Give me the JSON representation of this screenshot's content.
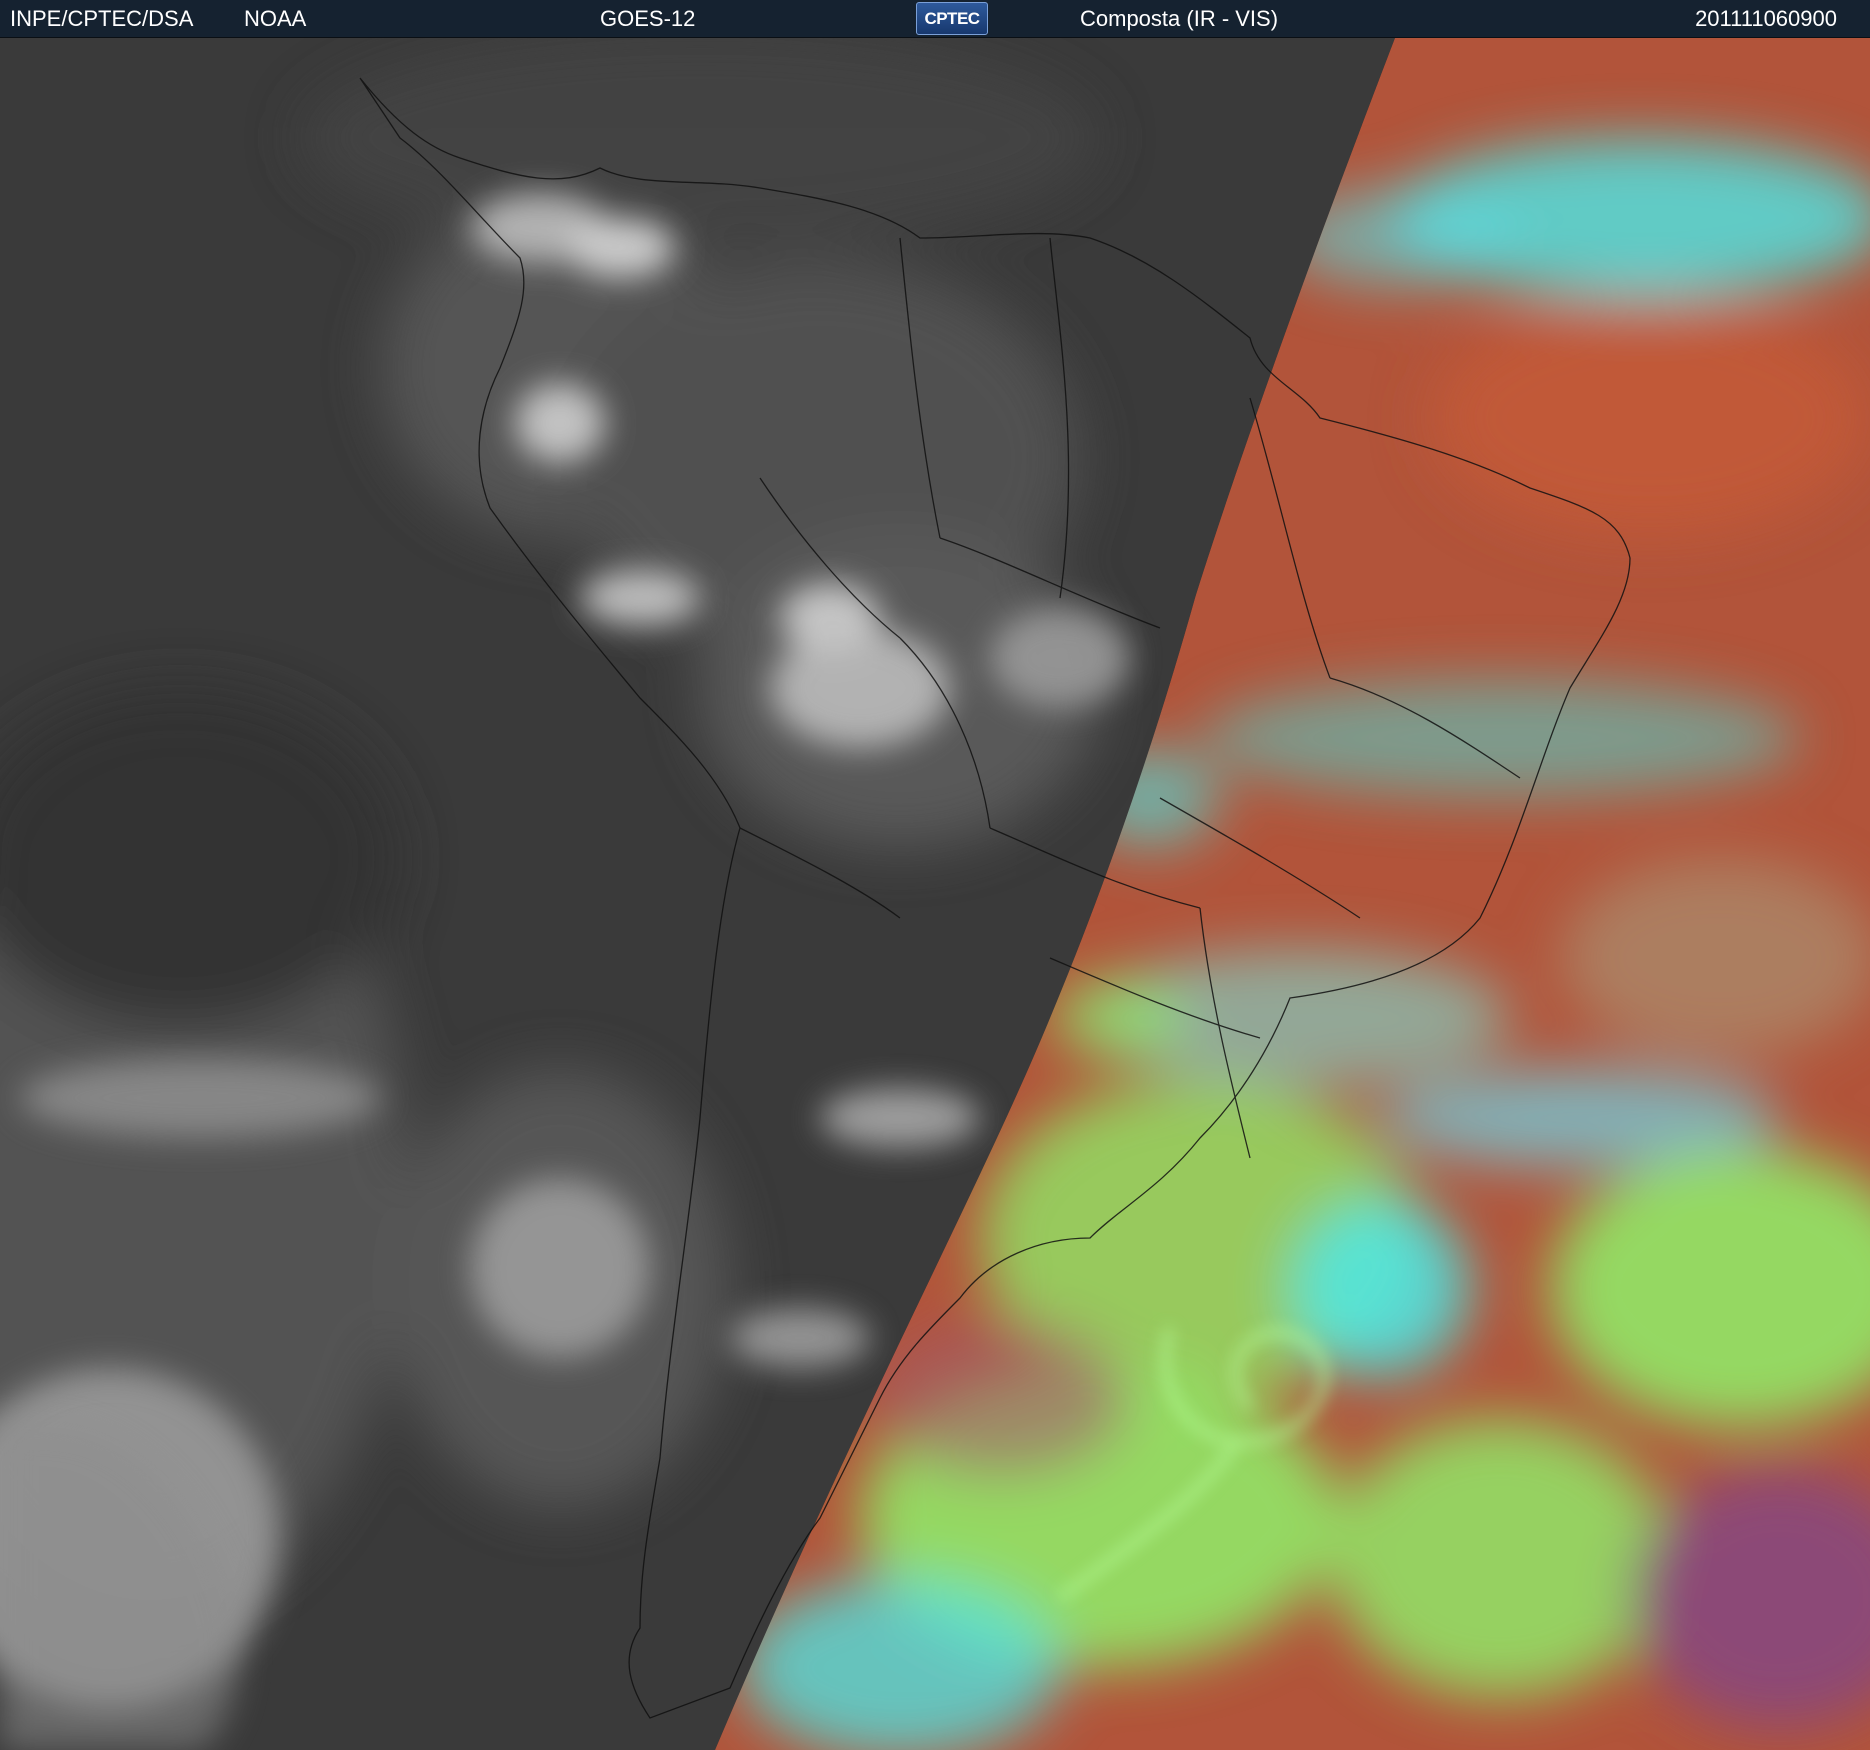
{
  "header": {
    "organization": "INPE/CPTEC/DSA",
    "agency": "NOAA",
    "satellite": "GOES-12",
    "logo_text": "CPTEC",
    "product": "Composta (IR - VIS)",
    "timestamp": "201111060900"
  },
  "colors": {
    "header_bg": "#152230",
    "night_ir": "#3a3a3a",
    "day_ocean": "#b2543a",
    "day_cloud_green": "#8ff06a",
    "day_cloud_cyan": "#4de8e8",
    "day_magenta": "#8a4a7a"
  }
}
